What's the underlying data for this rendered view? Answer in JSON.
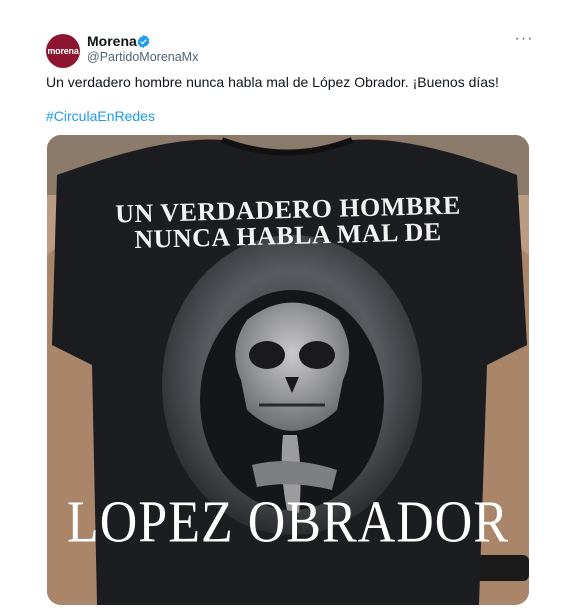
{
  "tweet": {
    "author": {
      "display_name": "Morena",
      "handle": "@PartidoMorenaMx",
      "avatar_text": "morena",
      "verified": true
    },
    "more_icon": "more-horizontal-icon",
    "text": "Un verdadero hombre nunca habla mal de López Obrador. ¡Buenos días!",
    "hashtag": "#CirculaEnRedes",
    "colors": {
      "brand": "#8e1530",
      "link": "#1d9bf0",
      "verified": "#1d9bf0"
    },
    "media": {
      "shirt_text_top_line1": "UN VERDADERO HOMBRE",
      "shirt_text_top_line2": "NUNCA HABLA MAL DE",
      "shirt_text_bottom": "LOPEZ OBRADOR",
      "graphic": "hooded-skull-shushing-icon"
    }
  }
}
